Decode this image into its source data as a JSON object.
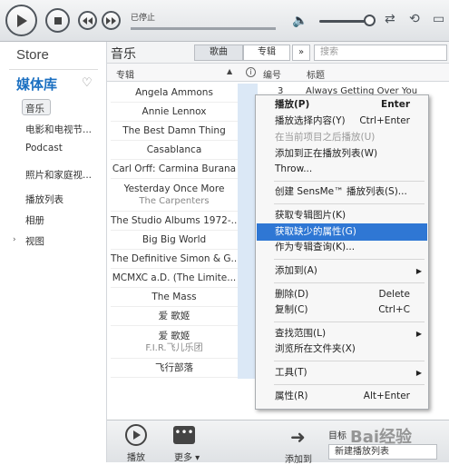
{
  "player": {
    "status_label": "已停止"
  },
  "sidebar": {
    "store_label": "Store",
    "library_label": "媒体库",
    "items": [
      {
        "label": "音乐"
      },
      {
        "label": "电影和电视节..."
      },
      {
        "label": "Podcast"
      },
      {
        "label": "照片和家庭视..."
      },
      {
        "label": "播放列表"
      },
      {
        "label": "相册"
      },
      {
        "label": "视图"
      }
    ]
  },
  "main": {
    "title": "音乐",
    "tabs": [
      {
        "label": "歌曲"
      },
      {
        "label": "专辑"
      }
    ],
    "more_tabs": "»",
    "search_placeholder": "搜索",
    "columns": [
      {
        "label": "专辑"
      },
      {
        "label": "编号"
      },
      {
        "label": "标题"
      }
    ],
    "albums": [
      {
        "name": "Angela Ammons",
        "sub": ""
      },
      {
        "name": "Annie Lennox",
        "sub": ""
      },
      {
        "name": "The Best Damn Thing",
        "sub": ""
      },
      {
        "name": "Casablanca",
        "sub": ""
      },
      {
        "name": "Carl Orff: Carmina Burana",
        "sub": ""
      },
      {
        "name": "Yesterday Once More",
        "sub": "The Carpenters"
      },
      {
        "name": "The Studio Albums 1972-...",
        "sub": ""
      },
      {
        "name": "Big Big World",
        "sub": ""
      },
      {
        "name": "The Definitive Simon & G...",
        "sub": ""
      },
      {
        "name": "MCMXC a.D. (The Limite...",
        "sub": ""
      },
      {
        "name": "The Mass",
        "sub": ""
      },
      {
        "name": "爱 歌姬",
        "sub": ""
      },
      {
        "name": "爱 歌姬",
        "sub": "F.I.R.飞儿乐团"
      },
      {
        "name": "飞行部落",
        "sub": ""
      }
    ],
    "visible_track": {
      "number": "3",
      "title": "Always Getting Over You"
    }
  },
  "context_menu": {
    "items": [
      {
        "label": "播放(P)",
        "shortcut": "Enter",
        "state": "bold"
      },
      {
        "label": "播放选择内容(Y)",
        "shortcut": "Ctrl+Enter",
        "state": "normal"
      },
      {
        "label": "在当前项目之后播放(U)",
        "shortcut": "",
        "state": "disabled"
      },
      {
        "label": "添加到正在播放列表(W)",
        "shortcut": "",
        "state": "normal"
      },
      {
        "label": "Throw...",
        "shortcut": "",
        "state": "normal"
      },
      {
        "label": "创建 SensMe™ 播放列表(S)...",
        "shortcut": "",
        "state": "normal"
      },
      {
        "label": "获取专辑图片(K)",
        "shortcut": "",
        "state": "normal"
      },
      {
        "label": "获取缺少的属性(G)",
        "shortcut": "",
        "state": "highlighted"
      },
      {
        "label": "作为专辑查询(K)...",
        "shortcut": "",
        "state": "normal"
      },
      {
        "label": "添加到(A)",
        "shortcut": "",
        "state": "submenu"
      },
      {
        "label": "删除(D)",
        "shortcut": "Delete",
        "state": "normal"
      },
      {
        "label": "复制(C)",
        "shortcut": "Ctrl+C",
        "state": "normal"
      },
      {
        "label": "查找范围(L)",
        "shortcut": "",
        "state": "submenu"
      },
      {
        "label": "浏览所在文件夹(X)",
        "shortcut": "",
        "state": "normal"
      },
      {
        "label": "工具(T)",
        "shortcut": "",
        "state": "submenu"
      },
      {
        "label": "属性(R)",
        "shortcut": "Alt+Enter",
        "state": "normal"
      }
    ]
  },
  "bottom": {
    "play_label": "播放",
    "more_label": "更多",
    "add_label": "添加到",
    "target_label": "目标",
    "playlist_label": "新建播放列表"
  },
  "watermark": "Bai经验"
}
